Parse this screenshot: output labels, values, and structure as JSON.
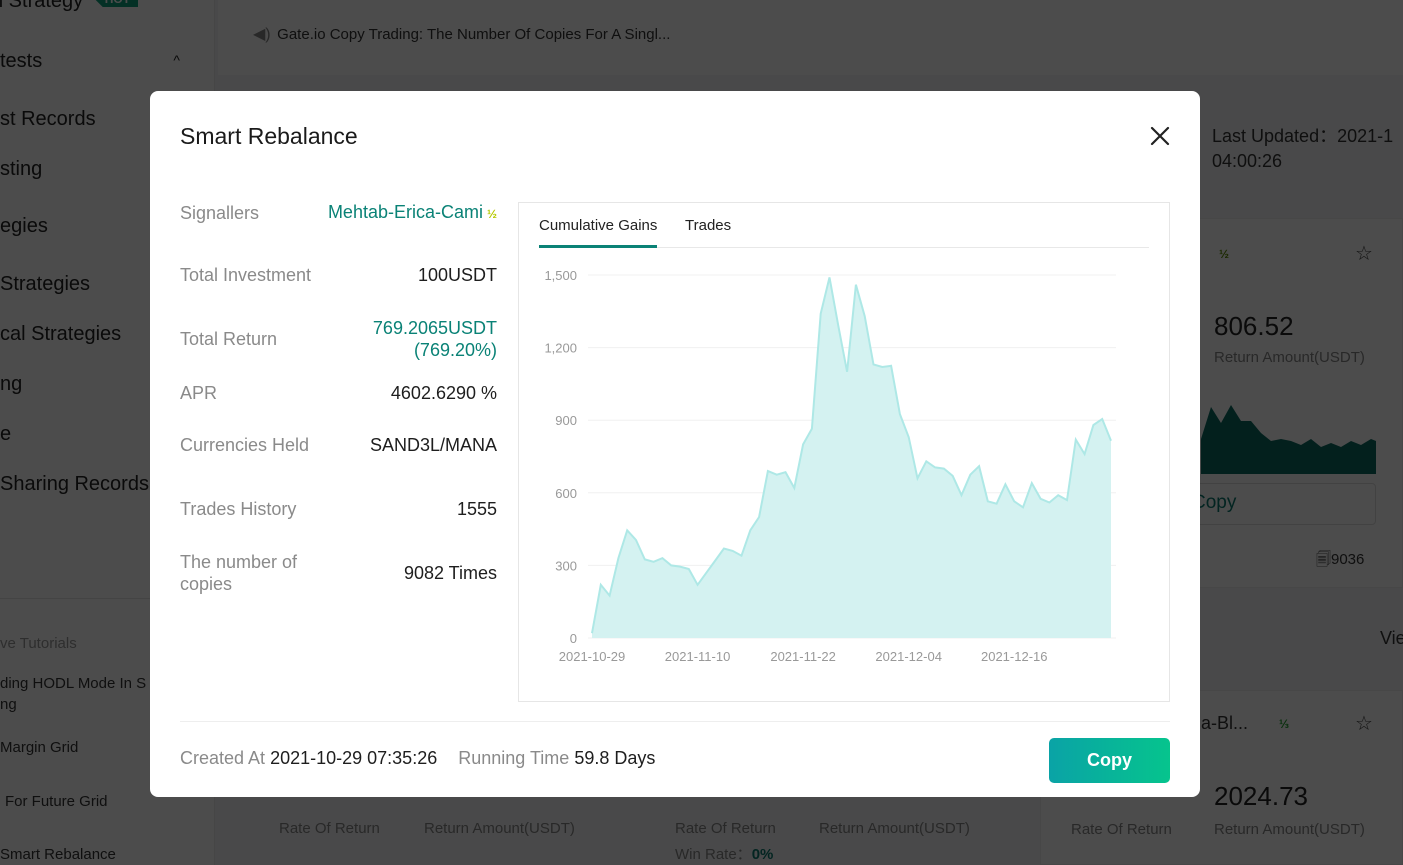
{
  "background": {
    "sidebar": {
      "hot_item": "n Strategy",
      "hot_badge": "HOT",
      "group_label": "tests",
      "items": [
        "st Records",
        "sting",
        "egies",
        "Strategies",
        "cal Strategies",
        "ng",
        "e",
        "Sharing Records"
      ],
      "tutorials_heading": "ve Tutorials",
      "tutorials": [
        "ding HODL Mode In S",
        "ng",
        "Margin Grid",
        "For Future Grid",
        "Smart Rebalance"
      ]
    },
    "notice": "Gate.io Copy Trading: The Number Of Copies For A Singl...",
    "last_updated": {
      "label": "Last Updated：2021-1",
      "time": "04:00:26"
    },
    "cards": [
      {
        "name_suffix": ".",
        "badge": "½",
        "return_amount": "806.52",
        "return_amount_label": "Return Amount(USDT)",
        "copy_label": "Copy",
        "copies": "9036"
      },
      {
        "name": "ua-Bl...",
        "badge": "⅓",
        "return_amount": "2024.73",
        "return_amount_label": "Return Amount(USDT)",
        "rate_label": "Rate Of Return"
      }
    ],
    "bottom_row": {
      "rate_label": "Rate Of Return",
      "return_label": "Return Amount(USDT)",
      "win_rate_label": "Win Rate：",
      "win_rate_value": "0%"
    },
    "view_link": "Vie"
  },
  "modal": {
    "title": "Smart Rebalance",
    "close_icon": "close-icon",
    "fields": [
      {
        "label": "Signallers",
        "value": "Mehtab-Erica-Cami",
        "badge": "½",
        "accent": true
      },
      {
        "label": "Total Investment",
        "value": "100USDT"
      },
      {
        "label": "Total Return",
        "value": "769.2065USDT\n(769.20%)",
        "accent": true
      },
      {
        "label": "APR",
        "value": "4602.6290 %"
      },
      {
        "label": "Currencies Held",
        "value": "SAND3L/MANA"
      },
      {
        "label": "Trades History",
        "value": "1555"
      },
      {
        "label": "The number of copies",
        "value": "9082 Times"
      }
    ],
    "tabs": [
      {
        "label": "Cumulative Gains",
        "active": true
      },
      {
        "label": "Trades",
        "active": false
      }
    ],
    "footer": {
      "created_label": "Created At",
      "created_value": "2021-10-29 07:35:26",
      "running_label": "Running Time",
      "running_value": "59.8 Days"
    },
    "copy_button": "Copy",
    "colors": {
      "accent": "#0a8276",
      "area_fill": "#d4f2f1",
      "area_line": "#aee8e6",
      "button_from": "#0aa3a6",
      "button_to": "#06c48d"
    }
  },
  "chart_data": {
    "type": "area",
    "title": "Cumulative Gains",
    "xlabel": "",
    "ylabel": "",
    "ylim": [
      0,
      1500
    ],
    "yticks": [
      0,
      300,
      600,
      900,
      1200,
      1500
    ],
    "ytick_labels": [
      "0",
      "300",
      "600",
      "900",
      "1,200",
      "1,500"
    ],
    "xtick_labels": [
      "2021-10-29",
      "2021-11-10",
      "2021-11-22",
      "2021-12-04",
      "2021-12-16"
    ],
    "grid": true,
    "legend": "none",
    "series": [
      {
        "name": "Cumulative Gains",
        "values": [
          20,
          220,
          175,
          330,
          445,
          405,
          325,
          315,
          330,
          300,
          295,
          285,
          220,
          270,
          320,
          370,
          360,
          340,
          445,
          500,
          690,
          675,
          685,
          620,
          800,
          865,
          1340,
          1490,
          1290,
          1100,
          1460,
          1330,
          1130,
          1120,
          1125,
          925,
          830,
          660,
          730,
          705,
          700,
          670,
          590,
          675,
          710,
          565,
          555,
          635,
          565,
          540,
          640,
          575,
          560,
          590,
          570,
          820,
          760,
          880,
          905,
          815
        ]
      }
    ]
  }
}
